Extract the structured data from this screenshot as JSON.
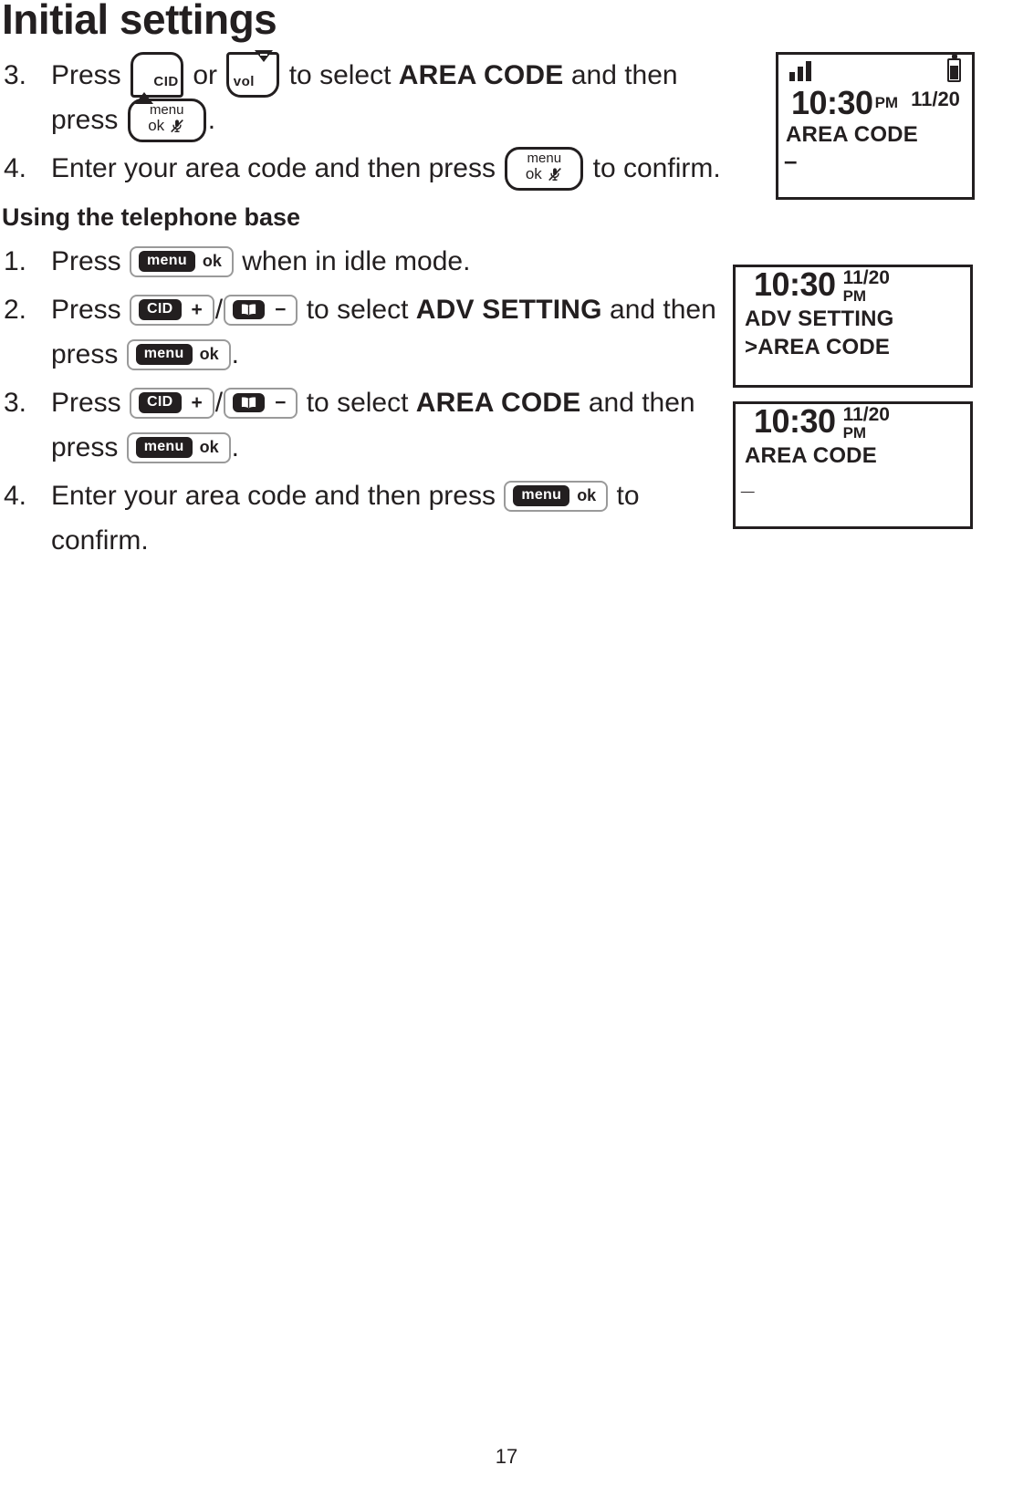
{
  "document": {
    "title": "Initial settings",
    "page_number": "17"
  },
  "section_handset": {
    "steps": [
      {
        "number": "3.",
        "parts": [
          {
            "type": "text",
            "value": "Press "
          },
          {
            "type": "key",
            "key": "cid_handset"
          },
          {
            "type": "text",
            "value": " or "
          },
          {
            "type": "key",
            "key": "vol_handset"
          },
          {
            "type": "text",
            "value": " to select "
          },
          {
            "type": "bold",
            "value": "AREA CODE"
          },
          {
            "type": "text",
            "value": " and then press "
          },
          {
            "type": "key",
            "key": "menuok_handset"
          },
          {
            "type": "text",
            "value": "."
          }
        ]
      },
      {
        "number": "4.",
        "parts": [
          {
            "type": "text",
            "value": "Enter your area code and then press "
          },
          {
            "type": "key",
            "key": "menuok_handset"
          },
          {
            "type": "text",
            "value": " to confirm."
          }
        ]
      }
    ]
  },
  "section_base": {
    "heading": "Using the telephone base",
    "steps": [
      {
        "number": "1.",
        "parts": [
          {
            "type": "text",
            "value": "Press "
          },
          {
            "type": "key",
            "key": "menuok_base"
          },
          {
            "type": "text",
            "value": " when in idle mode."
          }
        ]
      },
      {
        "number": "2.",
        "parts": [
          {
            "type": "text",
            "value": "Press "
          },
          {
            "type": "key",
            "key": "cid_base"
          },
          {
            "type": "text",
            "value": "/"
          },
          {
            "type": "key",
            "key": "phonebook_base"
          },
          {
            "type": "text",
            "value": " to select "
          },
          {
            "type": "bold",
            "value": "ADV SETTING"
          },
          {
            "type": "text",
            "value": " and then press "
          },
          {
            "type": "key",
            "key": "menuok_base"
          },
          {
            "type": "text",
            "value": "."
          }
        ]
      },
      {
        "number": "3.",
        "parts": [
          {
            "type": "text",
            "value": "Press "
          },
          {
            "type": "key",
            "key": "cid_base"
          },
          {
            "type": "text",
            "value": "/"
          },
          {
            "type": "key",
            "key": "phonebook_base"
          },
          {
            "type": "text",
            "value": " to select "
          },
          {
            "type": "bold",
            "value": "AREA CODE"
          },
          {
            "type": "text",
            "value": " and then press "
          },
          {
            "type": "key",
            "key": "menuok_base"
          },
          {
            "type": "text",
            "value": "."
          }
        ]
      },
      {
        "number": "4.",
        "parts": [
          {
            "type": "text",
            "value": "Enter your area code and then press "
          },
          {
            "type": "key",
            "key": "menuok_base"
          },
          {
            "type": "text",
            "value": " to confirm."
          }
        ]
      }
    ]
  },
  "keys": {
    "cid_handset": {
      "label": "CID",
      "symbol": "+",
      "icon": "triangle-up-plus-icon"
    },
    "vol_handset": {
      "label": "vol",
      "symbol": "-",
      "icon": "triangle-down-minus-icon"
    },
    "menuok_handset": {
      "line1": "menu",
      "line2": "ok",
      "icon": "mute-microphone-icon"
    },
    "menuok_base": {
      "pill": "menu",
      "label": "ok"
    },
    "cid_base": {
      "pill": "CID",
      "sign": "+"
    },
    "phonebook_base": {
      "pill_icon": "phonebook-icon",
      "sign": "−"
    }
  },
  "screens": [
    {
      "id": "lcd-1",
      "name": "handset-area-code-entry-screen",
      "statusbar": {
        "signal": "3-bars",
        "battery": "battery-icon"
      },
      "time": "10:30",
      "ampm": "PM",
      "date": "11/20",
      "lines": [
        "AREA CODE"
      ],
      "cursor": "–"
    },
    {
      "id": "lcd-2",
      "name": "base-adv-setting-screen",
      "time": "10:30",
      "ampm": "PM",
      "date": "11/20",
      "lines": [
        "ADV SETTING",
        ">AREA CODE"
      ],
      "cursor": ""
    },
    {
      "id": "lcd-3",
      "name": "base-area-code-entry-screen",
      "time": "10:30",
      "ampm": "PM",
      "date": "11/20",
      "lines": [
        "AREA CODE"
      ],
      "cursor": "_"
    }
  ],
  "colors": {
    "ink": "#231f20",
    "paper": "#ffffff",
    "key_border": "#9a9a9a"
  }
}
